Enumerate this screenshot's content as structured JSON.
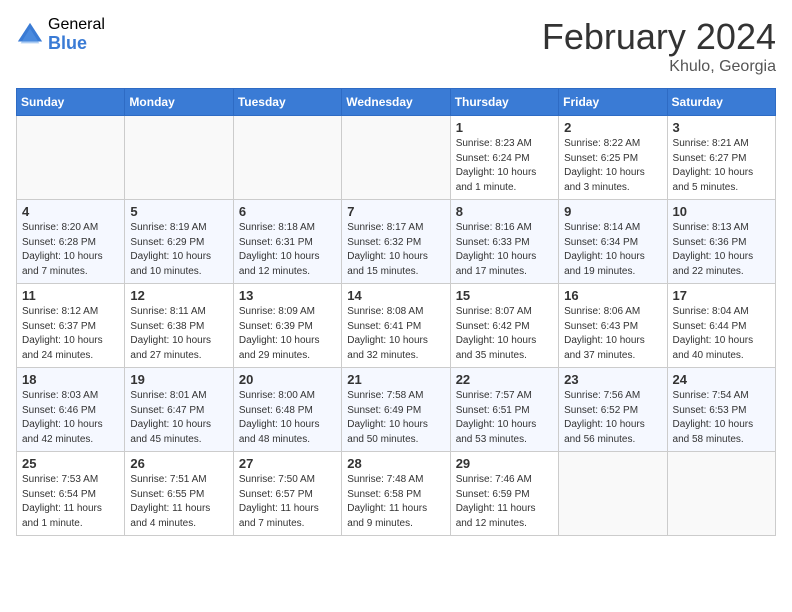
{
  "header": {
    "logo_general": "General",
    "logo_blue": "Blue",
    "title": "February 2024",
    "location": "Khulo, Georgia"
  },
  "days_of_week": [
    "Sunday",
    "Monday",
    "Tuesday",
    "Wednesday",
    "Thursday",
    "Friday",
    "Saturday"
  ],
  "weeks": [
    [
      {
        "day": "",
        "info": ""
      },
      {
        "day": "",
        "info": ""
      },
      {
        "day": "",
        "info": ""
      },
      {
        "day": "",
        "info": ""
      },
      {
        "day": "1",
        "info": "Sunrise: 8:23 AM\nSunset: 6:24 PM\nDaylight: 10 hours\nand 1 minute."
      },
      {
        "day": "2",
        "info": "Sunrise: 8:22 AM\nSunset: 6:25 PM\nDaylight: 10 hours\nand 3 minutes."
      },
      {
        "day": "3",
        "info": "Sunrise: 8:21 AM\nSunset: 6:27 PM\nDaylight: 10 hours\nand 5 minutes."
      }
    ],
    [
      {
        "day": "4",
        "info": "Sunrise: 8:20 AM\nSunset: 6:28 PM\nDaylight: 10 hours\nand 7 minutes."
      },
      {
        "day": "5",
        "info": "Sunrise: 8:19 AM\nSunset: 6:29 PM\nDaylight: 10 hours\nand 10 minutes."
      },
      {
        "day": "6",
        "info": "Sunrise: 8:18 AM\nSunset: 6:31 PM\nDaylight: 10 hours\nand 12 minutes."
      },
      {
        "day": "7",
        "info": "Sunrise: 8:17 AM\nSunset: 6:32 PM\nDaylight: 10 hours\nand 15 minutes."
      },
      {
        "day": "8",
        "info": "Sunrise: 8:16 AM\nSunset: 6:33 PM\nDaylight: 10 hours\nand 17 minutes."
      },
      {
        "day": "9",
        "info": "Sunrise: 8:14 AM\nSunset: 6:34 PM\nDaylight: 10 hours\nand 19 minutes."
      },
      {
        "day": "10",
        "info": "Sunrise: 8:13 AM\nSunset: 6:36 PM\nDaylight: 10 hours\nand 22 minutes."
      }
    ],
    [
      {
        "day": "11",
        "info": "Sunrise: 8:12 AM\nSunset: 6:37 PM\nDaylight: 10 hours\nand 24 minutes."
      },
      {
        "day": "12",
        "info": "Sunrise: 8:11 AM\nSunset: 6:38 PM\nDaylight: 10 hours\nand 27 minutes."
      },
      {
        "day": "13",
        "info": "Sunrise: 8:09 AM\nSunset: 6:39 PM\nDaylight: 10 hours\nand 29 minutes."
      },
      {
        "day": "14",
        "info": "Sunrise: 8:08 AM\nSunset: 6:41 PM\nDaylight: 10 hours\nand 32 minutes."
      },
      {
        "day": "15",
        "info": "Sunrise: 8:07 AM\nSunset: 6:42 PM\nDaylight: 10 hours\nand 35 minutes."
      },
      {
        "day": "16",
        "info": "Sunrise: 8:06 AM\nSunset: 6:43 PM\nDaylight: 10 hours\nand 37 minutes."
      },
      {
        "day": "17",
        "info": "Sunrise: 8:04 AM\nSunset: 6:44 PM\nDaylight: 10 hours\nand 40 minutes."
      }
    ],
    [
      {
        "day": "18",
        "info": "Sunrise: 8:03 AM\nSunset: 6:46 PM\nDaylight: 10 hours\nand 42 minutes."
      },
      {
        "day": "19",
        "info": "Sunrise: 8:01 AM\nSunset: 6:47 PM\nDaylight: 10 hours\nand 45 minutes."
      },
      {
        "day": "20",
        "info": "Sunrise: 8:00 AM\nSunset: 6:48 PM\nDaylight: 10 hours\nand 48 minutes."
      },
      {
        "day": "21",
        "info": "Sunrise: 7:58 AM\nSunset: 6:49 PM\nDaylight: 10 hours\nand 50 minutes."
      },
      {
        "day": "22",
        "info": "Sunrise: 7:57 AM\nSunset: 6:51 PM\nDaylight: 10 hours\nand 53 minutes."
      },
      {
        "day": "23",
        "info": "Sunrise: 7:56 AM\nSunset: 6:52 PM\nDaylight: 10 hours\nand 56 minutes."
      },
      {
        "day": "24",
        "info": "Sunrise: 7:54 AM\nSunset: 6:53 PM\nDaylight: 10 hours\nand 58 minutes."
      }
    ],
    [
      {
        "day": "25",
        "info": "Sunrise: 7:53 AM\nSunset: 6:54 PM\nDaylight: 11 hours\nand 1 minute."
      },
      {
        "day": "26",
        "info": "Sunrise: 7:51 AM\nSunset: 6:55 PM\nDaylight: 11 hours\nand 4 minutes."
      },
      {
        "day": "27",
        "info": "Sunrise: 7:50 AM\nSunset: 6:57 PM\nDaylight: 11 hours\nand 7 minutes."
      },
      {
        "day": "28",
        "info": "Sunrise: 7:48 AM\nSunset: 6:58 PM\nDaylight: 11 hours\nand 9 minutes."
      },
      {
        "day": "29",
        "info": "Sunrise: 7:46 AM\nSunset: 6:59 PM\nDaylight: 11 hours\nand 12 minutes."
      },
      {
        "day": "",
        "info": ""
      },
      {
        "day": "",
        "info": ""
      }
    ]
  ]
}
